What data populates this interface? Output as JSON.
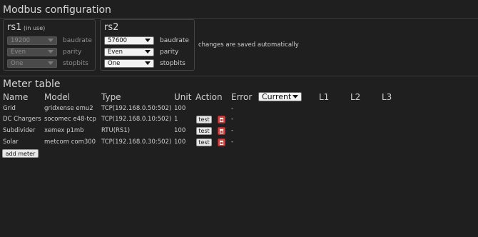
{
  "modbus": {
    "title": "Modbus configuration",
    "rs1": {
      "name": "rs1",
      "in_use": "(in use)",
      "baudrate": {
        "value": "19200",
        "label": "baudrate"
      },
      "parity": {
        "value": "Even",
        "label": "parity"
      },
      "stopbits": {
        "value": "One",
        "label": "stopbits"
      }
    },
    "rs2": {
      "name": "rs2",
      "baudrate": {
        "value": "57600",
        "label": "baudrate"
      },
      "parity": {
        "value": "Even",
        "label": "parity"
      },
      "stopbits": {
        "value": "One",
        "label": "stopbits"
      }
    },
    "note": "changes are saved automatically"
  },
  "meter_table": {
    "title": "Meter table",
    "headers": {
      "name": "Name",
      "model": "Model",
      "type": "Type",
      "unit": "Unit",
      "action": "Action",
      "error": "Error",
      "l1": "L1",
      "l2": "L2",
      "l3": "L3"
    },
    "measurement_select": "Current",
    "rows": [
      {
        "name": "Grid",
        "model": "gridxense emu2",
        "type": "TCP(192.168.0.50:502)",
        "unit": "100",
        "test": "test",
        "error": "-"
      },
      {
        "name": "DC Chargers",
        "model": "socomec e48-tcp",
        "type": "TCP(192.168.0.10:502)",
        "unit": "1",
        "test": "test",
        "error": "-"
      },
      {
        "name": "Subdivider",
        "model": "xemex p1mb",
        "type": "RTU(RS1)",
        "unit": "100",
        "test": "test",
        "error": "-"
      },
      {
        "name": "Solar",
        "model": "metcom com300",
        "type": "TCP(192.168.0.30:502)",
        "unit": "100",
        "test": "test",
        "error": "-"
      }
    ],
    "add_button": "add meter"
  },
  "colors": {
    "background": "#1f1f1f",
    "delete": "#d94040"
  }
}
